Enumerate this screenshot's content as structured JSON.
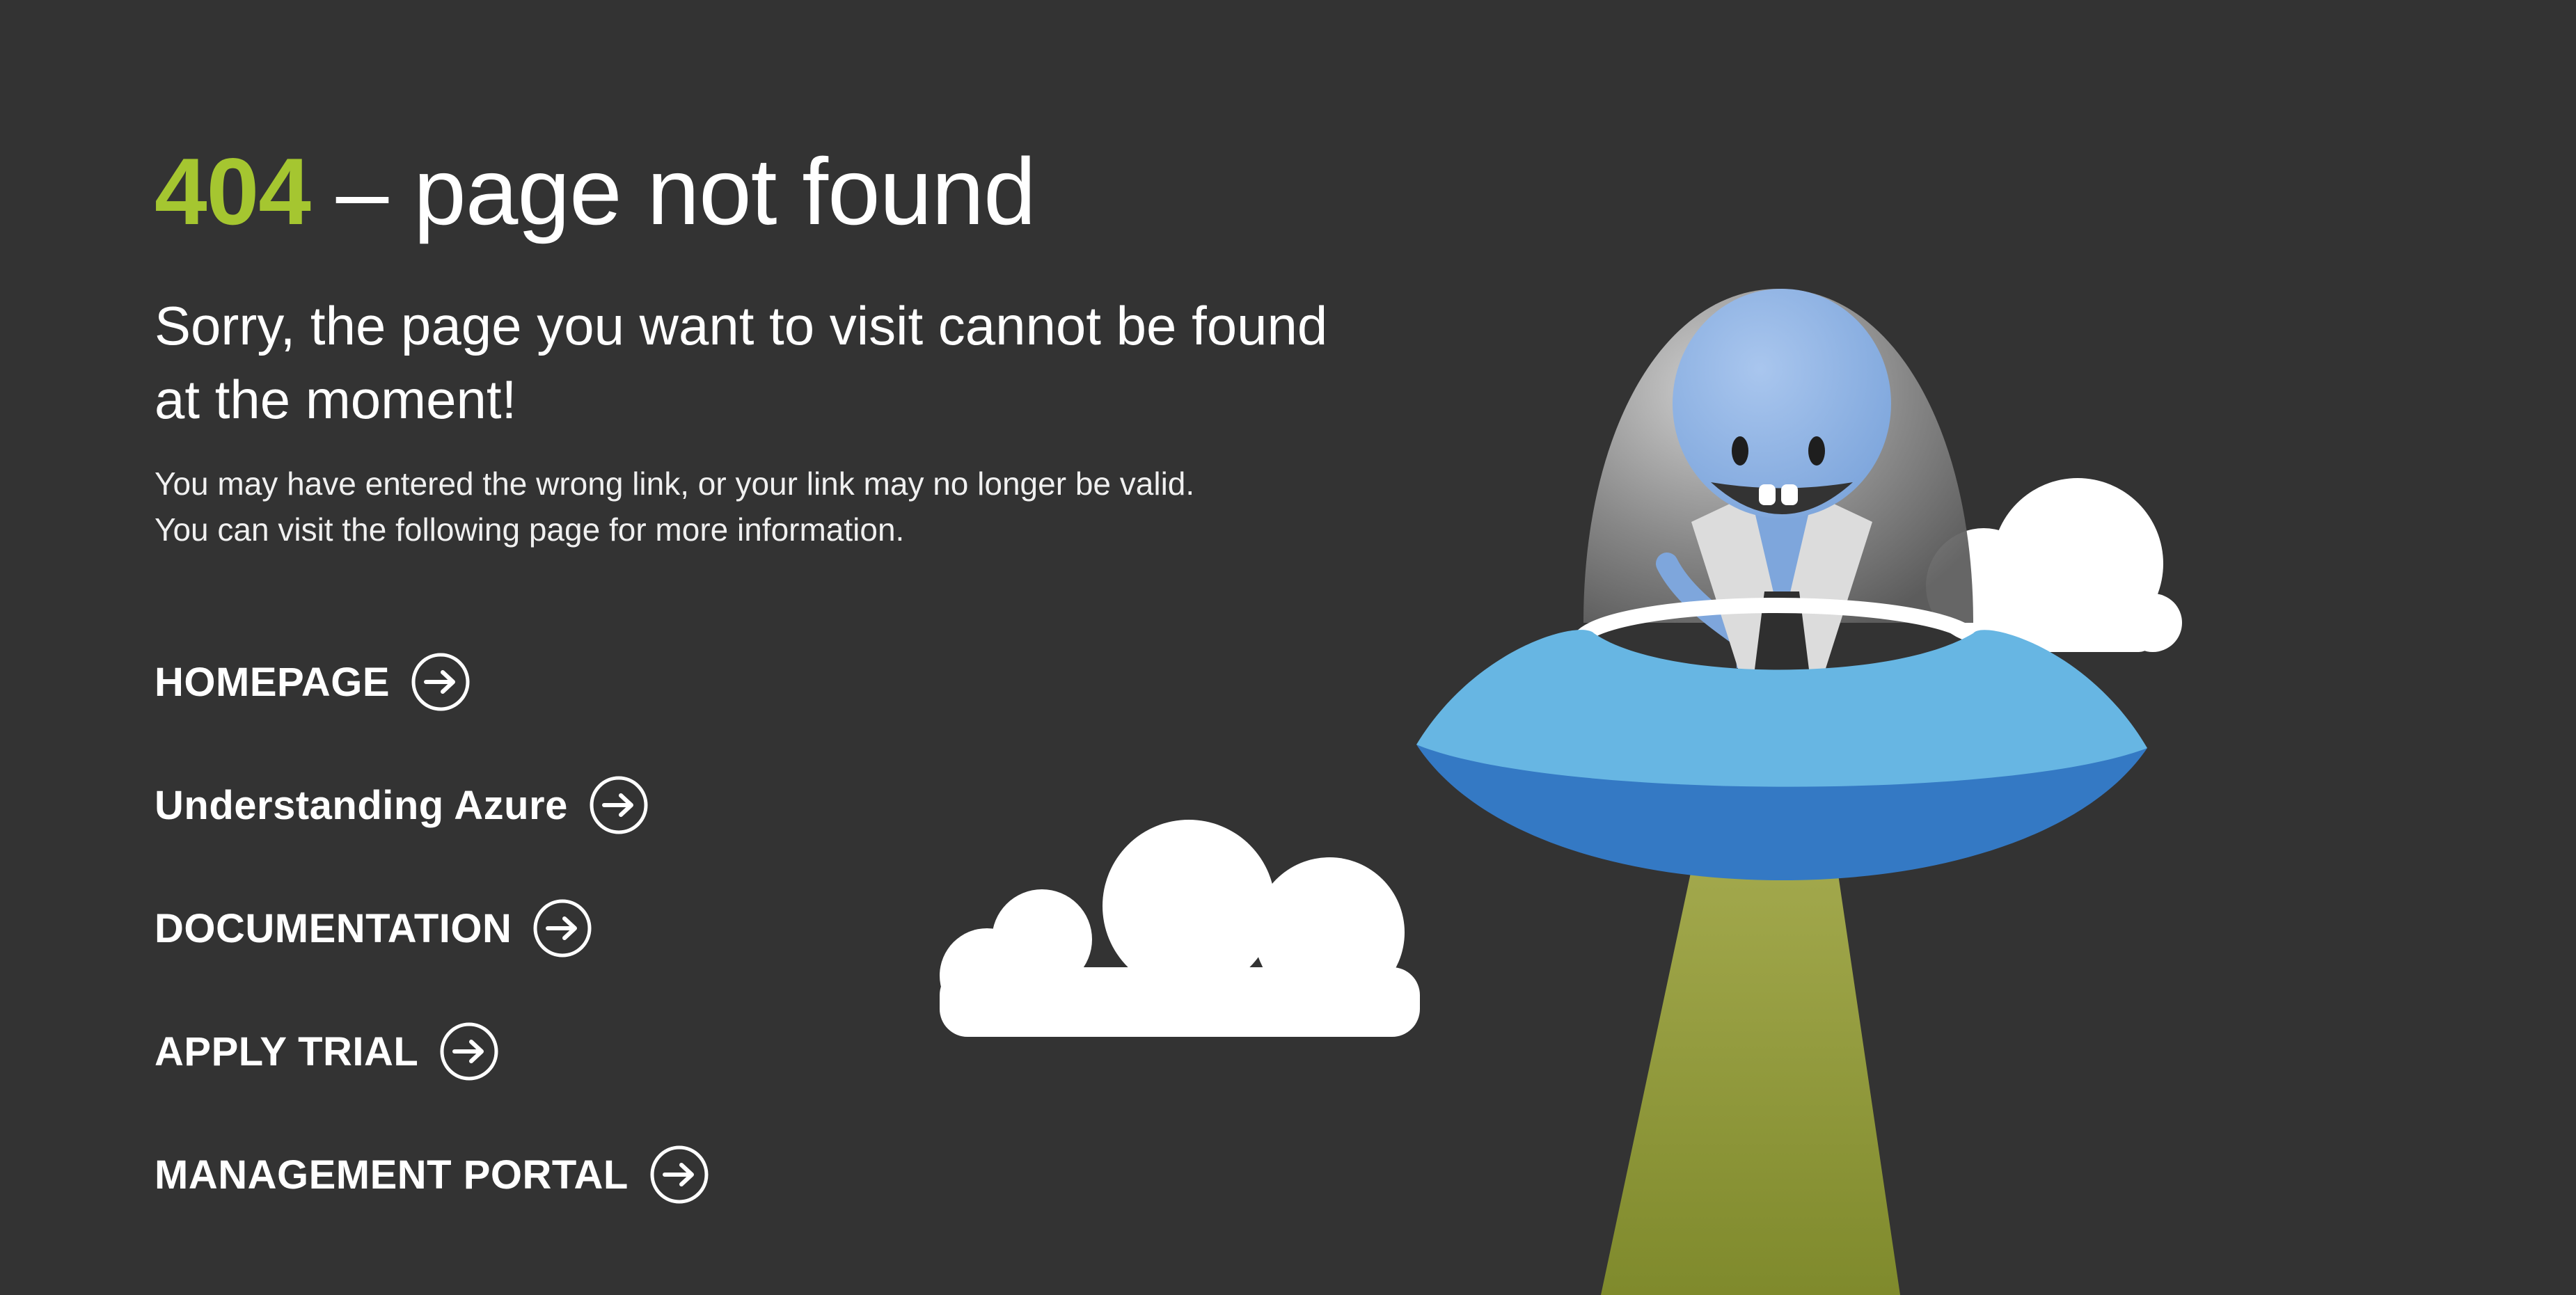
{
  "header": {
    "code": "404",
    "rest": " – page not found"
  },
  "subtitle": "Sorry, the page you want to visit cannot be found at the moment!",
  "description": {
    "line1": "You may have entered the wrong link, or your link may no longer be valid.",
    "line2": "You can visit the following page for more information."
  },
  "links": [
    {
      "label": "HOMEPAGE",
      "icon": "arrow-right-circle-icon"
    },
    {
      "label": "Understanding Azure",
      "icon": "arrow-right-circle-icon"
    },
    {
      "label": "DOCUMENTATION",
      "icon": "arrow-right-circle-icon"
    },
    {
      "label": "APPLY TRIAL",
      "icon": "arrow-right-circle-icon"
    },
    {
      "label": "MANAGEMENT PORTAL",
      "icon": "arrow-right-circle-icon"
    }
  ],
  "colors": {
    "background": "#333333",
    "accent": "#a5c630",
    "text": "#ffffff"
  }
}
